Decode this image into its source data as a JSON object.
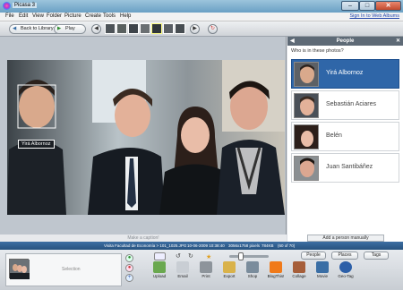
{
  "window": {
    "title": "Picasa 3",
    "min": "–",
    "max": "□",
    "close": "✕"
  },
  "menu": {
    "items": [
      "File",
      "Edit",
      "View",
      "Folder",
      "Picture",
      "Create",
      "Tools",
      "Help"
    ],
    "signin": "Sign In to Web Albums"
  },
  "toolbar": {
    "back_label": "Back to Library",
    "play_label": "Play"
  },
  "panel": {
    "title": "People",
    "question": "Who is in these photos?",
    "people": [
      {
        "name": "Yirá Albornoz"
      },
      {
        "name": "Sebastián Aciares"
      },
      {
        "name": "Belén"
      },
      {
        "name": "Juan Santibáñez"
      }
    ],
    "add_button": "Add a person manually"
  },
  "photo": {
    "face_tag": "Yirá Albornoz"
  },
  "caption": {
    "placeholder": "Make a caption!"
  },
  "status": {
    "path": "Visita Facultad de Economía > 101_1025.JPG",
    "date": "10-06-2009 10:38:40",
    "size": "3056x1758 pixels",
    "filesize": "784KB",
    "count": "(60 of 70)"
  },
  "bottom": {
    "selection_label": "Selection",
    "tabs": {
      "people": "People",
      "places": "Places",
      "tags": "Tags"
    },
    "actions": [
      {
        "label": "Upload",
        "color": "#6aa84f"
      },
      {
        "label": "Email",
        "color": "#c9ced4"
      },
      {
        "label": "Print",
        "color": "#8d949b"
      },
      {
        "label": "Export",
        "color": "#d9b24a"
      },
      {
        "label": "Shop",
        "color": "#7a8c9c"
      },
      {
        "label": "BlogThis!",
        "color": "#f07a1a"
      },
      {
        "label": "Collage",
        "color": "#a65e3a"
      },
      {
        "label": "Movie",
        "color": "#3a6ea5"
      },
      {
        "label": "Geo-Tag",
        "color": "#2c5fa8"
      }
    ]
  }
}
